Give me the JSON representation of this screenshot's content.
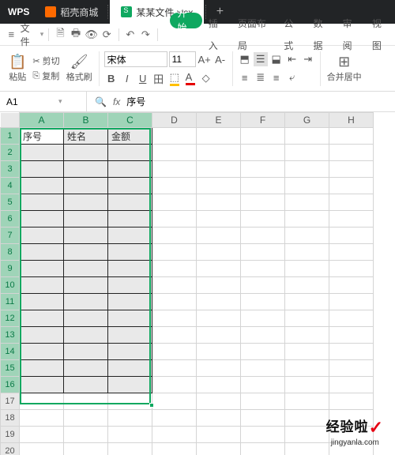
{
  "titlebar": {
    "app": "WPS",
    "store": "稻壳商城",
    "filename": "某某文件.xlsx",
    "plus": "+"
  },
  "menubar": {
    "menu_icon": "≡",
    "file_label": "文件",
    "icons": [
      "🗋",
      "🖨",
      "⎙",
      "⟳",
      "↶",
      "↷"
    ],
    "items": [
      "开始",
      "插入",
      "页面布局",
      "公式",
      "数据",
      "审阅",
      "视图"
    ]
  },
  "toolbar": {
    "paste_label": "粘贴",
    "cut_label": "剪切",
    "copy_label": "复制",
    "format_brush": "格式刷",
    "font_name": "宋体",
    "font_size": "11",
    "bold": "B",
    "italic": "I",
    "underline": "U",
    "border": "田",
    "fill": "⬚",
    "fontcolor": "A",
    "clear": "◇",
    "aplus": "A+",
    "aminus": "A-",
    "merge_label": "合并居中"
  },
  "formulabar": {
    "cellref": "A1",
    "search_icon": "🔍",
    "fx": "fx",
    "value": "序号"
  },
  "grid": {
    "cols": [
      "A",
      "B",
      "C",
      "D",
      "E",
      "F",
      "G",
      "H"
    ],
    "rows_visible": 20,
    "headers": {
      "A": "序号",
      "B": "姓名",
      "C": "金额"
    },
    "selection_rows": 16
  },
  "watermark": {
    "line1": "经验啦",
    "line2": "jingyanla.com"
  }
}
